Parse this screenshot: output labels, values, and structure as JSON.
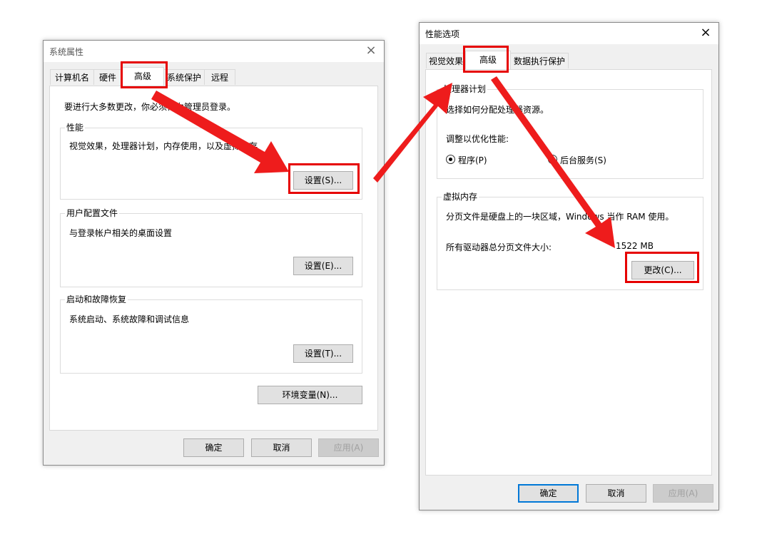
{
  "colors": {
    "accent": "#0078d7",
    "highlight": "#e60000",
    "arrow": "#ee1c1c"
  },
  "sysprops": {
    "title": "系统属性",
    "close_icon": "×",
    "tabs": [
      "计算机名",
      "硬件",
      "高级",
      "系统保护",
      "远程"
    ],
    "admin_note": "要进行大多数更改，你必须作为管理员登录。",
    "performance": {
      "title": "性能",
      "desc": "视觉效果，处理器计划，内存使用，以及虚拟内存",
      "button": "设置(S)..."
    },
    "user_profiles": {
      "title": "用户配置文件",
      "desc": "与登录帐户相关的桌面设置",
      "button": "设置(E)..."
    },
    "startup": {
      "title": "启动和故障恢复",
      "desc": "系统启动、系统故障和调试信息",
      "button": "设置(T)..."
    },
    "env_button": "环境变量(N)...",
    "ok": "确定",
    "cancel": "取消",
    "apply": "应用(A)"
  },
  "perfopts": {
    "title": "性能选项",
    "close_icon": "×",
    "tabs": [
      "视觉效果",
      "高级",
      "数据执行保护"
    ],
    "processor": {
      "title": "处理器计划",
      "desc": "选择如何分配处理器资源。",
      "adjust_label": "调整以优化性能:",
      "option_programs": "程序(P)",
      "option_services": "后台服务(S)"
    },
    "virtual_memory": {
      "title": "虚拟内存",
      "desc": "分页文件是硬盘上的一块区域，Windows 当作 RAM 使用。",
      "total_label": "所有驱动器总分页文件大小:",
      "total_value": "1522 MB",
      "button": "更改(C)..."
    },
    "ok": "确定",
    "cancel": "取消",
    "apply": "应用(A)"
  }
}
